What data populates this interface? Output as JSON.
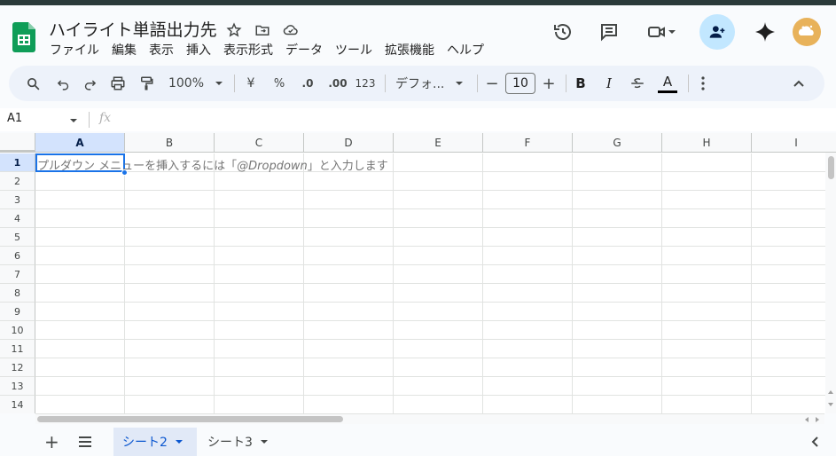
{
  "doc": {
    "title": "ハイライト単語出力先"
  },
  "menu": [
    "ファイル",
    "編集",
    "表示",
    "挿入",
    "表示形式",
    "データ",
    "ツール",
    "拡張機能",
    "ヘルプ"
  ],
  "toolbar": {
    "zoom": "100%",
    "currency": "¥",
    "percent": "%",
    "dec_decrease": ".0",
    "dec_increase": ".00",
    "number_format": "123",
    "font": "デフォ...",
    "font_size": "10",
    "bold": "B",
    "italic": "I",
    "text_color_letter": "A"
  },
  "formula_bar": {
    "name_box": "A1",
    "fx": "fx",
    "value": ""
  },
  "columns": [
    "A",
    "B",
    "C",
    "D",
    "E",
    "F",
    "G",
    "H",
    "I"
  ],
  "rows": [
    "1",
    "2",
    "3",
    "4",
    "5",
    "6",
    "7",
    "8",
    "9",
    "10",
    "11",
    "12",
    "13",
    "14"
  ],
  "cell_placeholder": {
    "before": "プルダウン メニューを挿入するには「",
    "mention": "@Dropdown",
    "after": "」と入力します"
  },
  "sheets": [
    {
      "name": "シート2",
      "active": true
    },
    {
      "name": "シート3",
      "active": false
    }
  ],
  "colors": {
    "accent": "#0b57d0",
    "selection": "#d3e3fd",
    "share_bg": "#c2e7ff",
    "sheets_green": "#0f9d58"
  }
}
